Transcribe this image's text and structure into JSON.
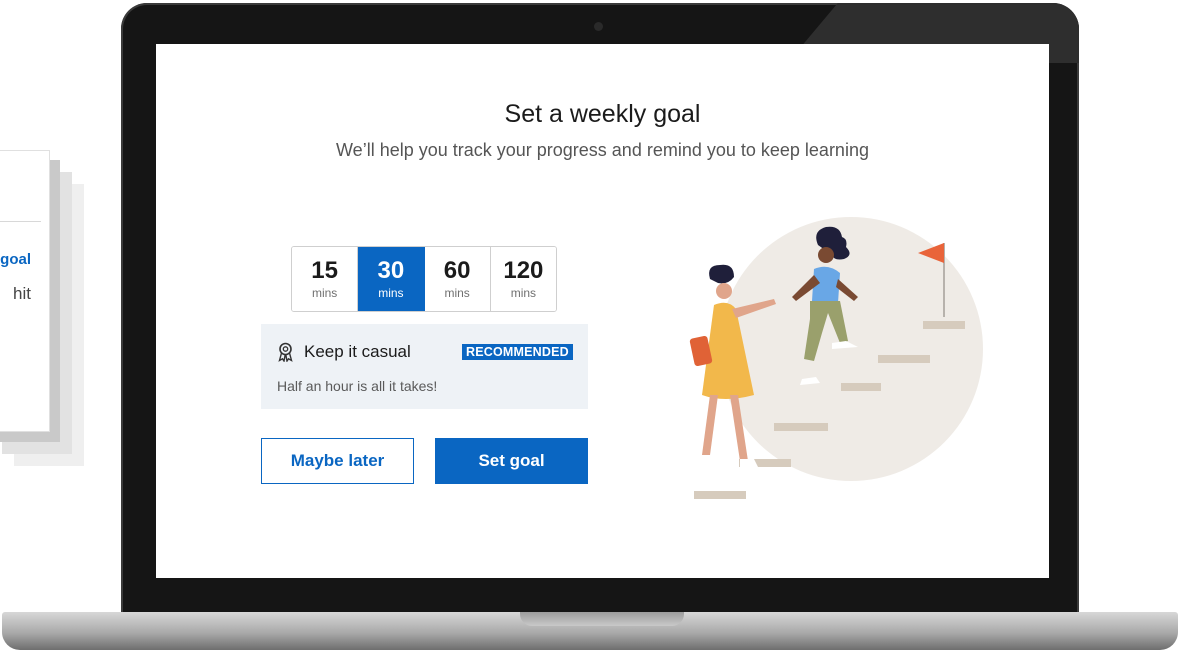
{
  "background_card": {
    "partial_link": "goal",
    "partial_text": "hit"
  },
  "dialog": {
    "title": "Set a weekly goal",
    "subtitle": "We’ll help you track your progress and remind you to keep learning"
  },
  "options": [
    {
      "value": "15",
      "unit": "mins",
      "selected": false
    },
    {
      "value": "30",
      "unit": "mins",
      "selected": true
    },
    {
      "value": "60",
      "unit": "mins",
      "selected": false
    },
    {
      "value": "120",
      "unit": "mins",
      "selected": false
    }
  ],
  "info": {
    "name": "Keep it casual",
    "tag": "RECOMMENDED",
    "description": "Half an hour is all it takes!",
    "icon": "award-ribbon-icon"
  },
  "buttons": {
    "later_label": "Maybe later",
    "set_label": "Set goal"
  },
  "colors": {
    "accent": "#0a66c2",
    "info_bg": "#eef2f6",
    "flag": "#e9643a",
    "circle": "#efebe6"
  }
}
